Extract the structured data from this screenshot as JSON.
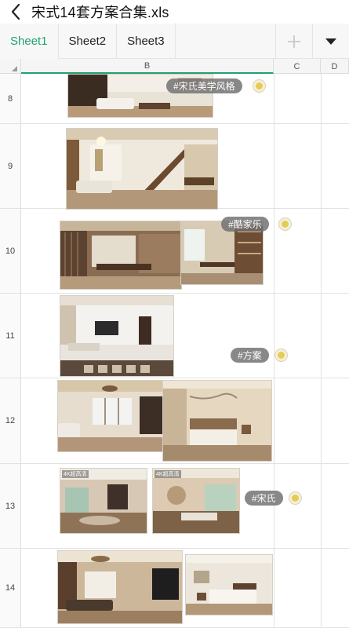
{
  "title_bar": {
    "back_icon": "chevron-left-icon",
    "file_name": "宋式14套方案合集.xls"
  },
  "sheets": {
    "tabs": [
      "Sheet1",
      "Sheet2",
      "Sheet3"
    ],
    "active": "Sheet1",
    "add_icon": "plus-icon",
    "menu_icon": "caret-down-icon"
  },
  "columns": [
    "B",
    "C",
    "D"
  ],
  "rows": [
    "8",
    "9",
    "10",
    "11",
    "12",
    "13",
    "14"
  ],
  "stickers": [
    "#宋氏美学风格",
    "#酷家乐",
    "#方案",
    "#宋氏"
  ],
  "image_badges": [
    "4K超高清",
    "4K超高清"
  ],
  "colors": {
    "accent": "#20a26f",
    "dot": "#e8cb55",
    "sticker_bg": "#6e6e6e"
  }
}
